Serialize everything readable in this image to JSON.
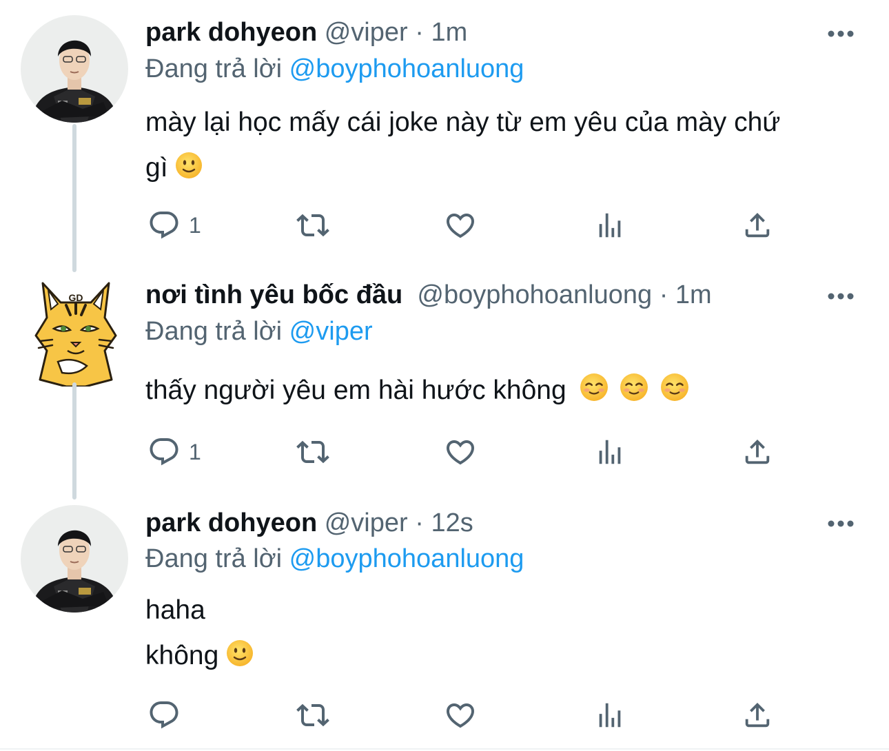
{
  "tweets": [
    {
      "name": "park dohyeon",
      "handle": "@viper",
      "separator": "·",
      "time": "1m",
      "reply_prefix": "Đang trả lời",
      "reply_to": "@boyphohoanluong",
      "text_lines": [
        "mày lại học mấy cái joke này từ em yêu của mày chứ",
        "gì"
      ],
      "reply_count": "1",
      "avatar_icon": "player-photo-avatar"
    },
    {
      "name": "nơi tình yêu bốc đầu",
      "handle": "@boyphohoanluong",
      "separator": "·",
      "time": "1m",
      "reply_prefix": "Đang trả lời",
      "reply_to": "@viper",
      "text_lines": [
        "thấy người yêu em hài hước không"
      ],
      "reply_count": "1",
      "avatar_icon": "tiger-cartoon-avatar"
    },
    {
      "name": "park dohyeon",
      "handle": "@viper",
      "separator": "·",
      "time": "12s",
      "reply_prefix": "Đang trả lời",
      "reply_to": "@boyphohoanluong",
      "text_lines": [
        "haha",
        "không"
      ],
      "reply_count": "",
      "avatar_icon": "player-photo-avatar"
    }
  ],
  "colors": {
    "text": "#0f1419",
    "muted": "#536471",
    "link": "#1d9bf0",
    "thread_line": "#cfd9de"
  },
  "icons": [
    "reply-icon",
    "retweet-icon",
    "like-icon",
    "views-icon",
    "share-icon",
    "more-icon",
    "slightly-smiling-emoji",
    "smiling-face-emoji"
  ]
}
